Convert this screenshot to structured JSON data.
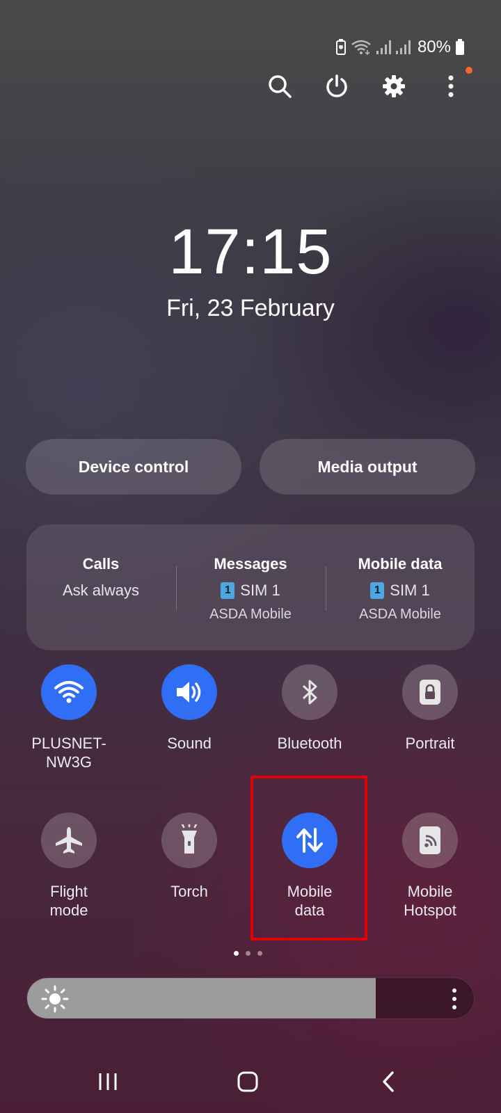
{
  "status_bar": {
    "battery_percent": "80%",
    "icons": [
      "battery-saver-icon",
      "wifi-icon",
      "signal-icon",
      "signal-icon",
      "battery-icon"
    ]
  },
  "top_actions": [
    {
      "name": "search-icon"
    },
    {
      "name": "power-icon"
    },
    {
      "name": "settings-gear-icon"
    },
    {
      "name": "more-options-icon"
    }
  ],
  "clock": {
    "time": "17:15",
    "date": "Fri, 23 February"
  },
  "pills": {
    "device_control": "Device control",
    "media_output": "Media output"
  },
  "sim_manager": {
    "calls": {
      "title": "Calls",
      "value": "Ask always"
    },
    "messages": {
      "title": "Messages",
      "sim_badge": "1",
      "value": "SIM 1",
      "carrier": "ASDA Mobile"
    },
    "mobile_data": {
      "title": "Mobile data",
      "sim_badge": "1",
      "value": "SIM 1",
      "carrier": "ASDA Mobile"
    }
  },
  "tiles": [
    {
      "id": "wifi",
      "label": "PLUSNET-NW3G",
      "icon": "wifi-icon",
      "on": true
    },
    {
      "id": "sound",
      "label": "Sound",
      "icon": "speaker-icon",
      "on": true
    },
    {
      "id": "bluetooth",
      "label": "Bluetooth",
      "icon": "bluetooth-icon",
      "on": false
    },
    {
      "id": "portrait",
      "label": "Portrait",
      "icon": "rotation-lock-icon",
      "on": false
    },
    {
      "id": "flight",
      "label": "Flight\nmode",
      "icon": "airplane-icon",
      "on": false
    },
    {
      "id": "torch",
      "label": "Torch",
      "icon": "flashlight-icon",
      "on": false
    },
    {
      "id": "mobile_data",
      "label": "Mobile\ndata",
      "icon": "data-arrows-icon",
      "on": true
    },
    {
      "id": "hotspot",
      "label": "Mobile\nHotspot",
      "icon": "hotspot-icon",
      "on": false
    }
  ],
  "page_indicator": {
    "pages": 3,
    "current": 1
  },
  "brightness": {
    "level": 0.78
  },
  "colors": {
    "accent": "#2f6ef5",
    "highlight": "#e00000",
    "notification_dot": "#ff6a2a"
  },
  "nav_bar": [
    "recents-icon",
    "home-icon",
    "back-icon"
  ]
}
